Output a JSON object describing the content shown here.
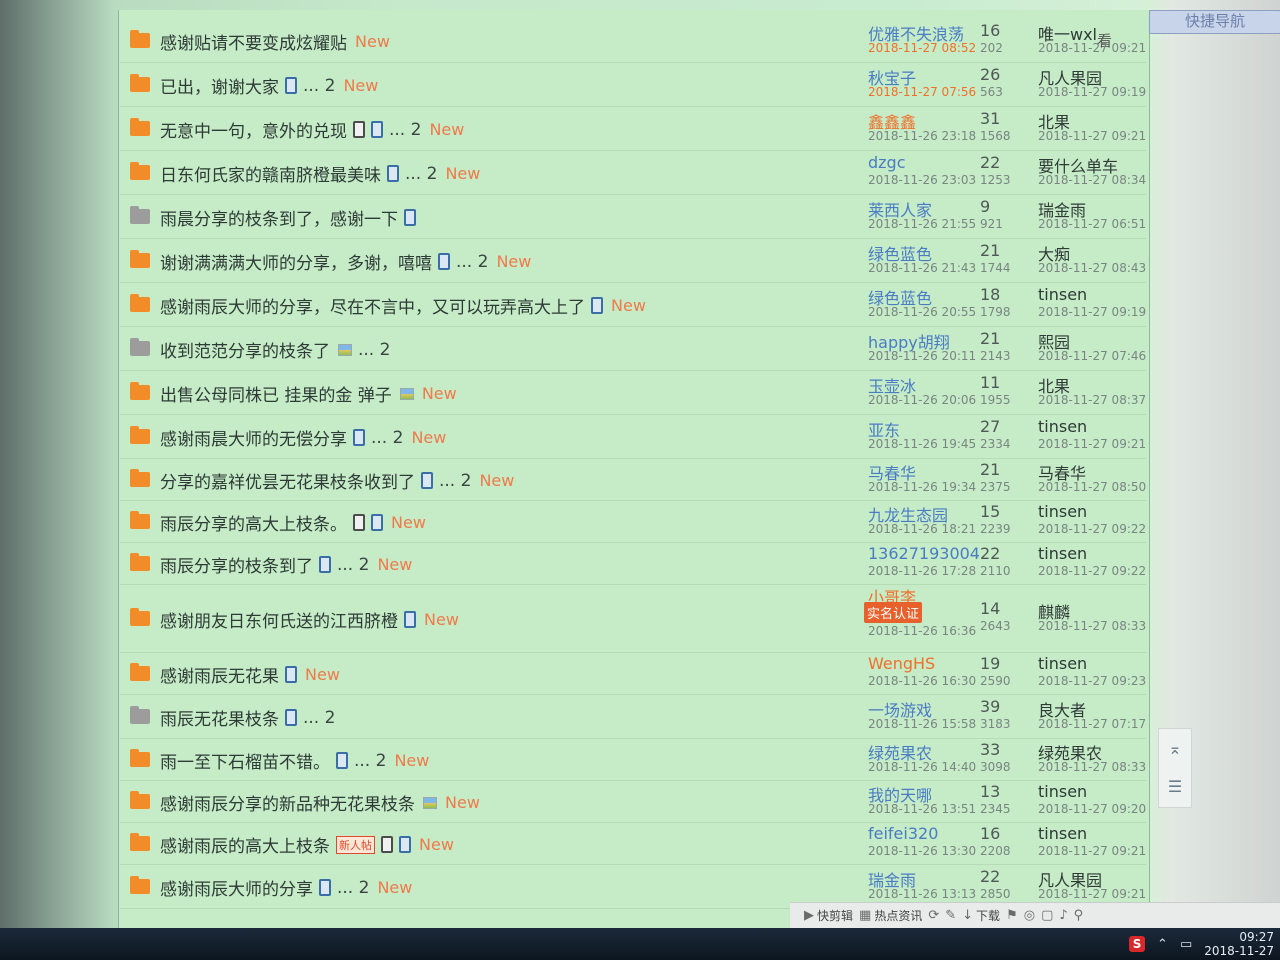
{
  "nav_button": "快捷导航",
  "column_header": "看",
  "threads": [
    {
      "title": "感谢贴请不要变成炫耀贴",
      "icon": "orange",
      "attach": "",
      "pages": "",
      "new": "New",
      "newbie": "",
      "author": "优雅不失浪荡",
      "author_color": "blue",
      "post_date": "2018-11-27 08:52",
      "date_color": "orange",
      "replies": "16",
      "views": "202",
      "last_user": "唯一wxl",
      "last_date": "2018-11-27 09:21",
      "badge": ""
    },
    {
      "title": "已出，谢谢大家",
      "icon": "orange",
      "attach": "blue",
      "pages": "... 2",
      "new": "New",
      "newbie": "",
      "author": "秋宝子",
      "author_color": "blue",
      "post_date": "2018-11-27 07:56",
      "date_color": "orange",
      "replies": "26",
      "views": "563",
      "last_user": "凡人果园",
      "last_date": "2018-11-27 09:19",
      "badge": ""
    },
    {
      "title": "无意中一句，意外的兑现",
      "icon": "orange",
      "attach": "both",
      "pages": "... 2",
      "new": "New",
      "newbie": "",
      "author": "鑫鑫鑫",
      "author_color": "orange",
      "post_date": "2018-11-26 23:18",
      "date_color": "gray",
      "replies": "31",
      "views": "1568",
      "last_user": "北果",
      "last_date": "2018-11-27 09:21",
      "badge": ""
    },
    {
      "title": "日东何氏家的赣南脐橙最美味",
      "icon": "orange",
      "attach": "blue",
      "pages": "... 2",
      "new": "New",
      "newbie": "",
      "author": "dzgc",
      "author_color": "blue",
      "post_date": "2018-11-26 23:03",
      "date_color": "gray",
      "replies": "22",
      "views": "1253",
      "last_user": "要什么单车",
      "last_date": "2018-11-27 08:34",
      "badge": ""
    },
    {
      "title": "雨晨分享的枝条到了，感谢一下",
      "icon": "gray",
      "attach": "blue",
      "pages": "",
      "new": "",
      "newbie": "",
      "author": "莱西人家",
      "author_color": "blue",
      "post_date": "2018-11-26 21:55",
      "date_color": "gray",
      "replies": "9",
      "views": "921",
      "last_user": "瑞金雨",
      "last_date": "2018-11-27 06:51",
      "badge": ""
    },
    {
      "title": "谢谢满满满大师的分享，多谢，嘻嘻",
      "icon": "orange",
      "attach": "blue",
      "pages": "... 2",
      "new": "New",
      "newbie": "",
      "author": "绿色蓝色",
      "author_color": "blue",
      "post_date": "2018-11-26 21:43",
      "date_color": "gray",
      "replies": "21",
      "views": "1744",
      "last_user": "大痴",
      "last_date": "2018-11-27 08:43",
      "badge": ""
    },
    {
      "title": "感谢雨辰大师的分享，尽在不言中，又可以玩弄高大上了",
      "icon": "orange",
      "attach": "blue",
      "pages": "",
      "new": "New",
      "newbie": "",
      "author": "绿色蓝色",
      "author_color": "blue",
      "post_date": "2018-11-26 20:55",
      "date_color": "gray",
      "replies": "18",
      "views": "1798",
      "last_user": "tinsen",
      "last_date": "2018-11-27 09:19",
      "badge": ""
    },
    {
      "title": "收到范范分享的枝条了",
      "icon": "gray",
      "attach": "img",
      "pages": "... 2",
      "new": "",
      "newbie": "",
      "author": "happy胡翔",
      "author_color": "blue",
      "post_date": "2018-11-26 20:11",
      "date_color": "gray",
      "replies": "21",
      "views": "2143",
      "last_user": "熙园",
      "last_date": "2018-11-27 07:46",
      "badge": ""
    },
    {
      "title": "出售公母同株已 挂果的金 弹子",
      "icon": "orange",
      "attach": "img",
      "pages": "",
      "new": "New",
      "newbie": "",
      "author": "玉壶冰",
      "author_color": "blue",
      "post_date": "2018-11-26 20:06",
      "date_color": "gray",
      "replies": "11",
      "views": "1955",
      "last_user": "北果",
      "last_date": "2018-11-27 08:37",
      "badge": ""
    },
    {
      "title": "感谢雨晨大师的无偿分享",
      "icon": "orange",
      "attach": "blue",
      "pages": "... 2",
      "new": "New",
      "newbie": "",
      "author": "亚东",
      "author_color": "blue",
      "post_date": "2018-11-26 19:45",
      "date_color": "gray",
      "replies": "27",
      "views": "2334",
      "last_user": "tinsen",
      "last_date": "2018-11-27 09:21",
      "badge": ""
    },
    {
      "title": "分享的嘉祥优昙无花果枝条收到了",
      "icon": "orange",
      "attach": "blue",
      "pages": "... 2",
      "new": "New",
      "newbie": "",
      "author": "马春华",
      "author_color": "blue",
      "post_date": "2018-11-26 19:34",
      "date_color": "gray",
      "replies": "21",
      "views": "2375",
      "last_user": "马春华",
      "last_date": "2018-11-27 08:50",
      "badge": ""
    },
    {
      "title": "雨辰分享的高大上枝条。",
      "icon": "orange",
      "attach": "both",
      "pages": "",
      "new": "New",
      "newbie": "",
      "author": "九龙生态园",
      "author_color": "blue",
      "post_date": "2018-11-26 18:21",
      "date_color": "gray",
      "replies": "15",
      "views": "2239",
      "last_user": "tinsen",
      "last_date": "2018-11-27 09:22",
      "badge": ""
    },
    {
      "title": "雨辰分享的枝条到了",
      "icon": "orange",
      "attach": "blue",
      "pages": "... 2",
      "new": "New",
      "newbie": "",
      "author": "13627193004",
      "author_color": "blue",
      "post_date": "2018-11-26 17:28",
      "date_color": "gray",
      "replies": "22",
      "views": "2110",
      "last_user": "tinsen",
      "last_date": "2018-11-27 09:22",
      "badge": ""
    },
    {
      "title": "感谢朋友日东何氏送的江西脐橙",
      "icon": "orange",
      "attach": "blue",
      "pages": "",
      "new": "New",
      "newbie": "",
      "author": "小哥李",
      "author_color": "orange",
      "post_date": "2018-11-26 16:36",
      "date_color": "gray",
      "replies": "14",
      "views": "2643",
      "last_user": "麒麟",
      "last_date": "2018-11-27 08:33",
      "badge": "实名认证"
    },
    {
      "title": "感谢雨辰无花果",
      "icon": "orange",
      "attach": "blue",
      "pages": "",
      "new": "New",
      "newbie": "",
      "author": "WengHS",
      "author_color": "orange",
      "post_date": "2018-11-26 16:30",
      "date_color": "gray",
      "replies": "19",
      "views": "2590",
      "last_user": "tinsen",
      "last_date": "2018-11-27 09:23",
      "badge": ""
    },
    {
      "title": "雨辰无花果枝条",
      "icon": "gray",
      "attach": "blue",
      "pages": "... 2",
      "new": "",
      "newbie": "",
      "author": "一场游戏",
      "author_color": "blue",
      "post_date": "2018-11-26 15:58",
      "date_color": "gray",
      "replies": "39",
      "views": "3183",
      "last_user": "良大者",
      "last_date": "2018-11-27 07:17",
      "badge": ""
    },
    {
      "title": "雨一至下石榴苗不错。",
      "icon": "orange",
      "attach": "blue",
      "pages": "... 2",
      "new": "New",
      "newbie": "",
      "author": "绿苑果农",
      "author_color": "blue",
      "post_date": "2018-11-26 14:40",
      "date_color": "gray",
      "replies": "33",
      "views": "3098",
      "last_user": "绿苑果农",
      "last_date": "2018-11-27 08:33",
      "badge": ""
    },
    {
      "title": "感谢雨辰分享的新品种无花果枝条",
      "icon": "orange",
      "attach": "img",
      "pages": "",
      "new": "New",
      "newbie": "",
      "author": "我的天哪",
      "author_color": "blue",
      "post_date": "2018-11-26 13:51",
      "date_color": "gray",
      "replies": "13",
      "views": "2345",
      "last_user": "tinsen",
      "last_date": "2018-11-27 09:20",
      "badge": ""
    },
    {
      "title": "感谢雨辰的高大上枝条",
      "icon": "orange",
      "attach": "both",
      "pages": "",
      "new": "New",
      "newbie": "新人帖",
      "author": "feifei320",
      "author_color": "blue",
      "post_date": "2018-11-26 13:30",
      "date_color": "gray",
      "replies": "16",
      "views": "2208",
      "last_user": "tinsen",
      "last_date": "2018-11-27 09:21",
      "badge": ""
    },
    {
      "title": "感谢雨辰大师的分享",
      "icon": "orange",
      "attach": "blue",
      "pages": "... 2",
      "new": "New",
      "newbie": "",
      "author": "瑞金雨",
      "author_color": "blue",
      "post_date": "2018-11-26 13:13",
      "date_color": "gray",
      "replies": "22",
      "views": "2850",
      "last_user": "凡人果园",
      "last_date": "2018-11-27 09:21",
      "badge": ""
    }
  ],
  "bottom_toolbar": {
    "items": [
      "快剪辑",
      "热点资讯",
      "下载"
    ]
  },
  "clock": {
    "time": "09:27",
    "date": "2018-11-27"
  },
  "tray_icon": "S"
}
